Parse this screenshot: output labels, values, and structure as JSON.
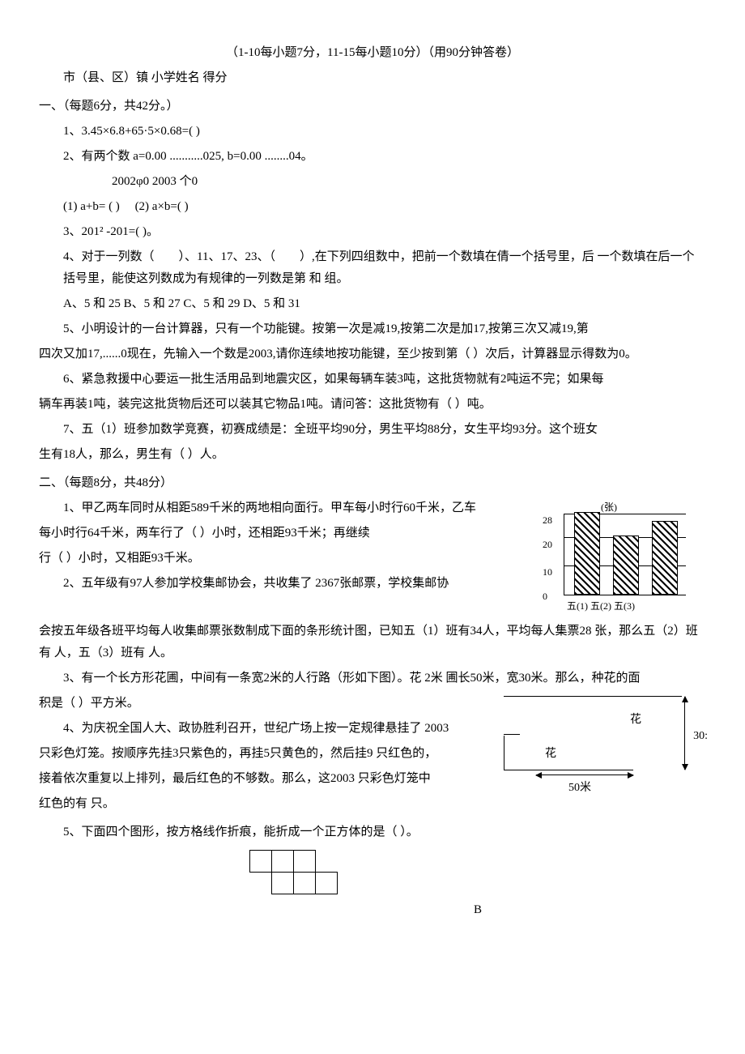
{
  "header": {
    "subtitle": "（1-10每小题7分，11-15每小题10分）（用90分钟答卷）",
    "info_line": "市（县、区）镇 小学姓名 得分"
  },
  "section1": {
    "title": "一、（每题6分，共42分。）",
    "q1": "1、3.45×6.8+65·5×0.68=(                        )",
    "q2a": "2、有两个数 a=0.00 ...........025,    b=0.00 ........04。",
    "q2b": "2002φ0               2003 个0",
    "q2c_1": "(1) a+b= (                                                )",
    "q2c_2": "(2) a×b=(                                                    )",
    "q3": "3、201² -201=(                        )。",
    "q4a": "4、对于一列数（　　）、11、17、23、（　　）,在下列四组数中，把前一个数填在倩一个括号里，后 一个数填在后一个括号里，能使这列数成为有规律的一列数是第 和 组。",
    "q4b": "A、5 和 25 B、5 和 27 C、5 和 29 D、5 和 31",
    "q5a": "5、小明设计的一台计算器，只有一个功能键。按第一次是减19,按第二次是加17,按第三次又减19,第",
    "q5b": "四次又加17,......0现在，先输入一个数是2003,请你连续地按功能键，至少按到第（                        ）次后，计算器显示得数为0。",
    "q6a": "6、紧急救援中心要运一批生活用品到地震灾区，如果每辆车装3吨，这批货物就有2吨运不完；如果每",
    "q6b": "辆车再装1吨，装完这批货物后还可以装其它物品1吨。请问答：这批货物有（                  ）吨。",
    "q7a": "7、五（1）班参加数学竞赛，初赛成绩是：全班平均90分，男生平均88分，女生平均93分。这个班女",
    "q7b": "生有18人，那么，男生有（              ）人。"
  },
  "section2": {
    "title": "二、（每题8分，共48分）",
    "q1a": "1、甲乙两车同时从相距589千米的两地相向面行。甲车每小时行60千米，乙车",
    "q1b": "每小时行64千米，两车行了（                 ）小时，还相距93千米；再继续",
    "q1c": "行（         ）小时，又相距93千米。",
    "q2a": "2、五年级有97人参加学校集邮协会，共收集了 2367张邮票，学校集邮协",
    "q2b": "会按五年级各班平均每人收集邮票张数制成下面的条形统计图，已知五（1）班有34人，平均每人集票28 张，那么五（2）班有 人，五（3）班有 人。",
    "q3a": "3、有一个长方形花圃，中间有一条宽2米的人行路（形如下图）。花 2米 圃长50米，宽30米。那么，种花的面",
    "q3b": "积是（                                                                ）平方米。",
    "q4a": "4、为庆祝全国人大、政协胜利召开，世纪广场上按一定规律悬挂了 2003",
    "q4b": "只彩色灯笼。按顺序先挂3只紫色的，再挂5只黄色的，然后挂9 只红色的，",
    "q4c": "接着依次重复以上排列，最后红色的不够数。那么，这2003 只彩色灯笼中",
    "q4d": "红色的有 只。",
    "q5": "5、下面四个图形，按方格线作折痕，能折成一个正方体的是（            ）。",
    "net_label": "B"
  },
  "figures": {
    "chart": {
      "unit": "(张)",
      "yticks": [
        "28",
        "20",
        "10",
        "0"
      ],
      "xlabels": "五(1) 五(2) 五(3)"
    },
    "flower": {
      "top_label": "花",
      "bottom_label": "花",
      "right_dim": "30:",
      "bottom_dim": "50米"
    }
  },
  "chart_data": {
    "type": "bar",
    "unit": "张",
    "categories": [
      "五(1)",
      "五(2)",
      "五(3)"
    ],
    "values": [
      28,
      20,
      25
    ],
    "ylim": [
      0,
      28
    ],
    "yticks": [
      0,
      10,
      20,
      28
    ],
    "notes": "Bars for 五(2) and 五(3) are unlabeled in the figure; heights estimated from gridlines."
  }
}
